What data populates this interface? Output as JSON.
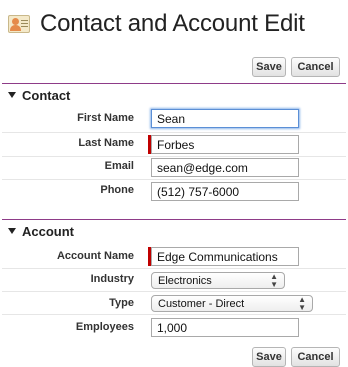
{
  "header": {
    "title": "Contact and Account Edit",
    "icon": "contact-card-icon"
  },
  "buttons": {
    "save_label": "Save",
    "cancel_label": "Cancel"
  },
  "contact": {
    "heading": "Contact",
    "fields": {
      "first_name": {
        "label": "First Name",
        "value": "Sean"
      },
      "last_name": {
        "label": "Last Name",
        "value": "Forbes"
      },
      "email": {
        "label": "Email",
        "value": "sean@edge.com"
      },
      "phone": {
        "label": "Phone",
        "value": "(512) 757-6000"
      }
    }
  },
  "account": {
    "heading": "Account",
    "fields": {
      "account_name": {
        "label": "Account Name",
        "value": "Edge Communications"
      },
      "industry": {
        "label": "Industry",
        "value": "Electronics"
      },
      "type": {
        "label": "Type",
        "value": "Customer - Direct"
      },
      "employees": {
        "label": "Employees",
        "value": "1,000"
      }
    }
  },
  "colors": {
    "divider": "#8e3b88",
    "required": "#c00000",
    "focus": "#5b8fd6"
  }
}
